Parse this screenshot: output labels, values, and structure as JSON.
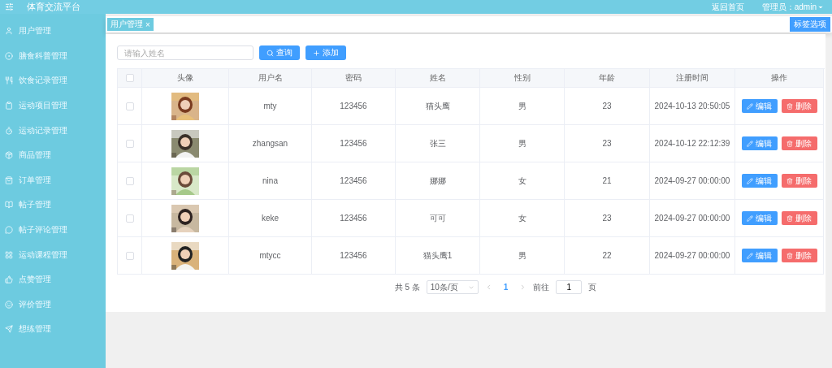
{
  "header": {
    "title": "体育交流平台",
    "links": [
      "返回首页"
    ],
    "user": "管理员：admin"
  },
  "sidebar": {
    "items": [
      {
        "label": "用户管理"
      },
      {
        "label": "膳食科普管理"
      },
      {
        "label": "饮食记录管理"
      },
      {
        "label": "运动项目管理"
      },
      {
        "label": "运动记录管理"
      },
      {
        "label": "商品管理"
      },
      {
        "label": "订单管理"
      },
      {
        "label": "帖子管理"
      },
      {
        "label": "帖子评论管理"
      },
      {
        "label": "运动课程管理"
      },
      {
        "label": "点赞管理"
      },
      {
        "label": "评价管理"
      },
      {
        "label": "想练管理"
      }
    ]
  },
  "tags": [
    {
      "label": "用户管理",
      "selected": true,
      "close": "×"
    }
  ],
  "tag_options": "标签选项",
  "search": {
    "placeholder": "请输入姓名",
    "query_button": "查询",
    "add_button": "添加"
  },
  "table": {
    "select_all_checked": false,
    "columns": [
      "头像",
      "用户名",
      "密码",
      "姓名",
      "性别",
      "年龄",
      "注册时间",
      "操作"
    ],
    "rows": [
      {
        "checked": false,
        "username": "mty",
        "password": "123456",
        "name": "猫头鹰",
        "gender": "男",
        "age": "23",
        "registered": "2024-10-13 20:50:05",
        "edit": "编辑",
        "delete": "删除"
      },
      {
        "checked": false,
        "username": "zhangsan",
        "password": "123456",
        "name": "张三",
        "gender": "男",
        "age": "23",
        "registered": "2024-10-12 22:12:39",
        "edit": "编辑",
        "delete": "删除"
      },
      {
        "checked": false,
        "username": "nina",
        "password": "123456",
        "name": "娜娜",
        "gender": "女",
        "age": "21",
        "registered": "2024-09-27 00:00:00",
        "edit": "编辑",
        "delete": "删除"
      },
      {
        "checked": false,
        "username": "keke",
        "password": "123456",
        "name": "可可",
        "gender": "女",
        "age": "23",
        "registered": "2024-09-27 00:00:00",
        "edit": "编辑",
        "delete": "删除"
      },
      {
        "checked": false,
        "username": "mtycc",
        "password": "123456",
        "name": "猫头鹰1",
        "gender": "男",
        "age": "22",
        "registered": "2024-09-27 00:00:00",
        "edit": "编辑",
        "delete": "删除"
      }
    ]
  },
  "pagination": {
    "total": "共 5 条",
    "page_size": "10条/页",
    "pages": [
      {
        "label": "1",
        "selected": true
      }
    ],
    "goto_label": "前往",
    "goto_value": "1",
    "goto_suffix": "页"
  }
}
